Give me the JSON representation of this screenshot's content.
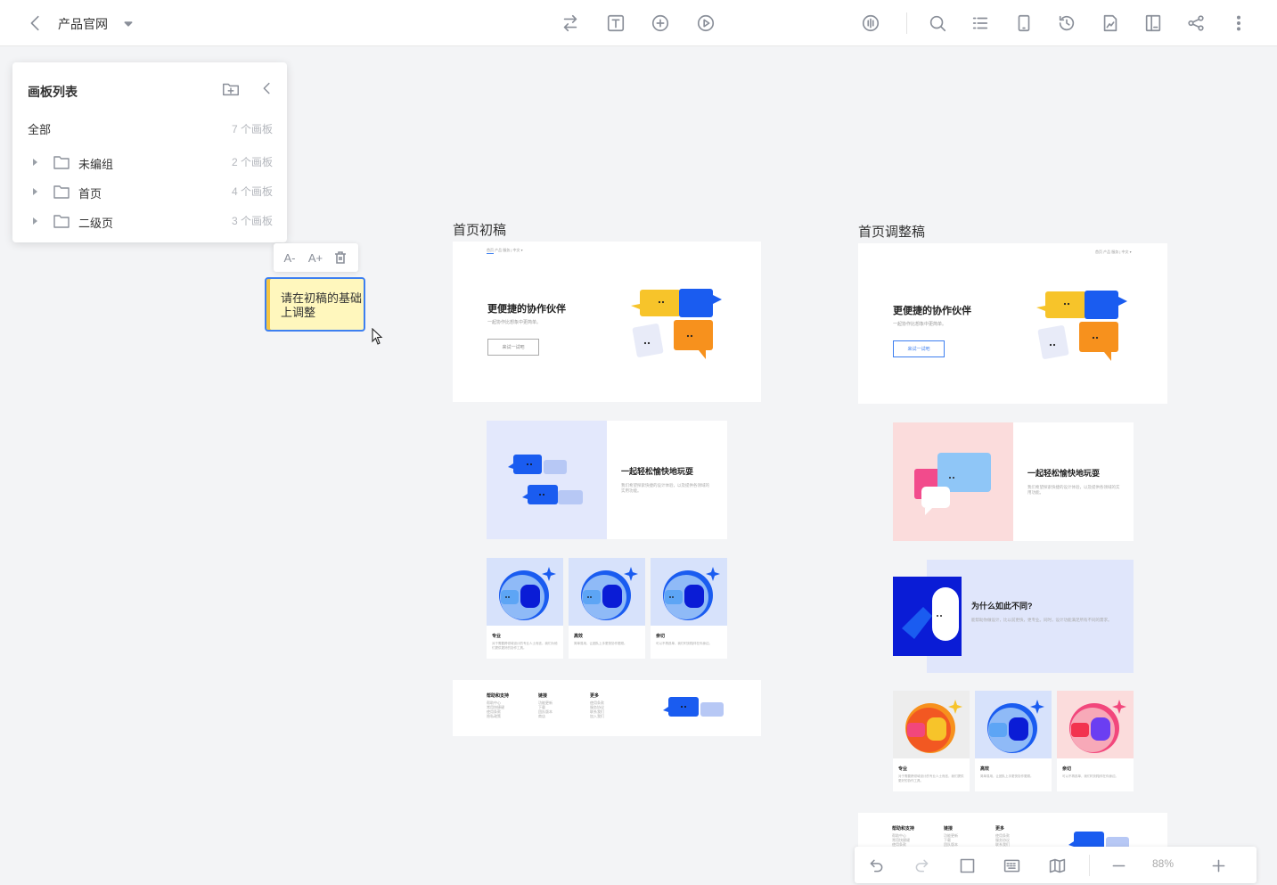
{
  "topbar": {
    "title": "产品官网",
    "left_icons": [
      "back-arrow-icon",
      "dropdown-caret-icon"
    ],
    "center_icons": [
      "flow-icon",
      "text-icon",
      "add-circle-icon",
      "play-icon"
    ],
    "right_icons": [
      "audio-icon",
      "search-icon",
      "list-icon",
      "mobile-icon",
      "history-icon",
      "image-icon",
      "grid-icon",
      "share-icon",
      "more-icon"
    ]
  },
  "panel": {
    "title": "画板列表",
    "all": {
      "label": "全部",
      "count": "7 个画板"
    },
    "groups": [
      {
        "label": "未编组",
        "count": "2 个画板"
      },
      {
        "label": "首页",
        "count": "4 个画板"
      },
      {
        "label": "二级页",
        "count": "3 个画板"
      }
    ]
  },
  "note": {
    "text": "请在初稿的基础上调整",
    "toolbar": {
      "decrease": "A-",
      "increase": "A+"
    }
  },
  "boards": {
    "draft": {
      "label": "首页初稿",
      "hero_title": "更便捷的协作伙伴",
      "hero_sub": "一起协作比想象中更简单。",
      "hero_btn": "来试一试吧",
      "nav": "首页   产品   服务   |   中文 ▾",
      "sec_title": "一起轻松愉快地玩耍",
      "sec_text": "我们希望探索快捷的设计体验，以及提供各领域的实用功能。",
      "cards": [
        {
          "title": "专业",
          "text": "对于需要跨领域设计的专业人士而言，我们为他们提供更好的协作工具。"
        },
        {
          "title": "高效",
          "text": "简单易用，让团队上手更快协作更顺。"
        },
        {
          "title": "亲切",
          "text": "可以不再孤单，我们时刻陪伴在你身边。"
        }
      ],
      "footer": [
        {
          "title": "帮助和支持",
          "items": [
            "帮助中心",
            "常用快捷键",
            "使用条款",
            "隐私政策"
          ]
        },
        {
          "title": "链接",
          "items": [
            "功能更新",
            "下载",
            "团队版本",
            "商店"
          ]
        },
        {
          "title": "更多",
          "items": [
            "使用条款",
            "服务协议",
            "联系我们",
            "加入我们"
          ]
        }
      ]
    },
    "revised": {
      "label": "首页调整稿",
      "hero_title": "更便捷的协作伙伴",
      "hero_sub": "一起协作比想象中更简单。",
      "hero_btn": "来试一试吧",
      "nav": "首页   产品   服务   |   中文 ▾",
      "sec_title": "一起轻松愉快地玩耍",
      "sec_text": "我们希望探索快捷的设计体验，以及提供各领域的实用功能。",
      "why_title": "为什么如此不同?",
      "why_text": "能帮助你做设计，比以前更快，更专业。同时，设计功能满足所有不同的需求。",
      "cards": [
        {
          "title": "专业",
          "text": "对于需要跨领域设计的专业人士而言，我们提供更好的协作工具。"
        },
        {
          "title": "高效",
          "text": "简单易用，让团队上手更快协作更顺。"
        },
        {
          "title": "亲切",
          "text": "可以不再孤单，我们时刻陪伴在你身边。"
        }
      ],
      "footer": [
        {
          "title": "帮助和支持",
          "items": [
            "帮助中心",
            "常用快捷键",
            "使用条款"
          ]
        },
        {
          "title": "链接",
          "items": [
            "功能更新",
            "下载",
            "团队版本"
          ]
        },
        {
          "title": "更多",
          "items": [
            "使用条款",
            "服务协议",
            "联系我们"
          ]
        }
      ]
    }
  },
  "bottombar": {
    "zoom": "88%",
    "icons": [
      "undo-icon",
      "redo-icon",
      "frame-icon",
      "keyboard-icon",
      "map-icon",
      "zoom-out-icon",
      "zoom-in-icon"
    ]
  },
  "colors": {
    "accent": "#3d7ff0",
    "note_bg": "#fff7bd",
    "yellow": "#f7c42a",
    "blue": "#1a5cf0",
    "orange": "#f7911d",
    "canvas": "#f3f4f6"
  }
}
